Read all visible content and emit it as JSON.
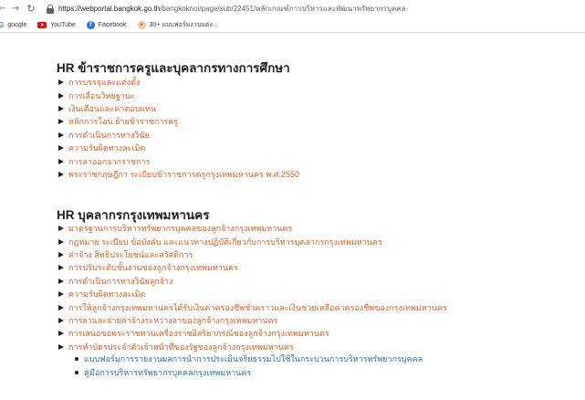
{
  "browser": {
    "url_host": "https://webportal.bangkok.go.th",
    "url_path": "/bangkoknoi/page/sub/22451/หลักเกณฑ์การบริหารและพัฒนาทรัพยากรบุคคล"
  },
  "bookmarks": [
    {
      "label": "google",
      "icon": "google-icon"
    },
    {
      "label": "YouTube",
      "icon": "youtube-icon"
    },
    {
      "label": "Facebook",
      "icon": "facebook-icon"
    },
    {
      "label": "30+ แบบฟอร์มงานแต่ง...",
      "icon": "bookmark-site-icon"
    }
  ],
  "section1": {
    "title": "HR ข้าราชการครูและบุคลากรทางการศึกษา",
    "items": [
      "การบรรจุและแต่งตั้ง",
      "การเลื่อนวิทยฐานะ",
      "เงินเดือนและค่าตอบแทน",
      "หลักการโอน ย้ายข้าราชการครู",
      "การดำเนินการทางวินัย",
      "ความรับผิดทางละเมิด",
      "การลาออกจากราชการ",
      "พระราชกฤษฎีกา ระเบียบข้าราชการครูกรุงเทพมหานคร พ.ศ.2550"
    ]
  },
  "section2": {
    "title": "HR บุคลากรกรุงเทพมหานคร",
    "items": [
      "มาตรฐานการบริหารทรัพยากรบุคคลของลูกจ้างกรุงเทพมหานคร",
      "กฎหมาย ระเบียบ ข้อบังคับ และแนวทางปฏิบัติเกี่ยวกับการบริหารบุคลากรกรุงเทพมหานคร",
      "ค่าจ้าง สิทธิประโยชน์และสวัสดิการ",
      "การปรับระดับชั้นงานของลูกจ้างกรุงเทพมหานคร",
      "การดำเนินการทางวินัยลูกจ้าง",
      "ความรับผิดทางละเมิด",
      "การให้ลูกจ้างกรุงเทพมหานครได้รับเงินค่าครองชีพชั่วคราวและเงินช่วยเหลือค่าครองชีพของกรุงเทพมหานคร",
      "การลาและจ่ายค่าจ้างระหว่างลาของลูกจ้างกรุงเทพมหานคร",
      "การเสนอขอพระราชทานเครื่องราชอิสริยาภรณ์ของลูกจ้างกรุงเทพมหานคร",
      "การทำบัตรประจำตัวเจ้าหน้าที่ของรัฐของลูกจ้างกรุงเทพมหานคร"
    ],
    "sub_items": [
      "แบบฟอร์มการรายงานผลการนำการประเมินจริยธรรมไปใช้ในกระบวนการบริหารทรัพยากรบุคคล",
      "คู่มือการบริหารทรัพยากรบุคคลกรุงเทพมหานคร"
    ]
  },
  "colors": {
    "link": "#e25a1c",
    "blue_link": "#2b6cb0",
    "heading": "#1f1f1f"
  }
}
